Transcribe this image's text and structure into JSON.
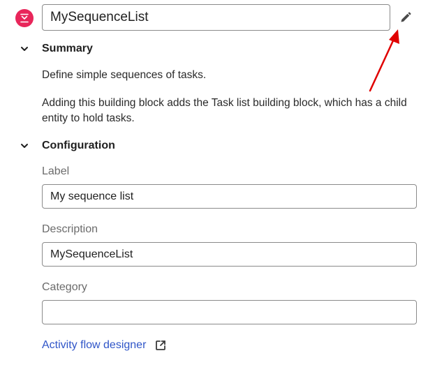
{
  "header": {
    "block_name": "MySequenceList"
  },
  "summary": {
    "title": "Summary",
    "description": "Define simple sequences of tasks.",
    "details": "Adding this building block adds the Task list building block, which has a child entity to hold tasks."
  },
  "configuration": {
    "title": "Configuration",
    "label": {
      "caption": "Label",
      "value": "My sequence list"
    },
    "description": {
      "caption": "Description",
      "value": "MySequenceList"
    },
    "category": {
      "caption": "Category",
      "value": ""
    }
  },
  "link": {
    "text": "Activity flow designer"
  },
  "colors": {
    "brand_icon": "#e8265a",
    "link": "#2f55c8",
    "annotation_arrow": "#e00000"
  },
  "icons": {
    "block": "sequence-list-icon",
    "edit": "pencil-icon",
    "collapse": "chevron-down-icon",
    "external": "external-link-icon"
  }
}
